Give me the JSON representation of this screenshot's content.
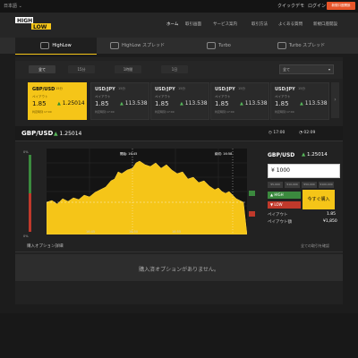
{
  "header": {
    "language": "日本語 ⌄",
    "quick_demo": "クイックデモ",
    "login": "ログイン",
    "free_account": "新規口座開設"
  },
  "logo": {
    "top": "HIGH",
    "bottom": "LOW"
  },
  "nav": [
    "ホーム",
    "取引画面",
    "サービス案内",
    "取引方法",
    "よくある質問",
    "新規口座開設"
  ],
  "tabs": [
    {
      "label": "HighLow",
      "icon": "highlow-icon"
    },
    {
      "label": "HighLow スプレッド",
      "icon": "spread-icon"
    },
    {
      "label": "Turbo",
      "icon": "turbo-icon"
    },
    {
      "label": "Turbo スプレッド",
      "icon": "turbo-spread-icon"
    }
  ],
  "filters": {
    "tabs": [
      "全て",
      "15分",
      "1時間",
      "1日"
    ],
    "select": "全て"
  },
  "cards": [
    {
      "pair": "GBP/USD",
      "time": "15分",
      "payout_label": "ペイアウト",
      "payout": "1.85",
      "rate": "1.25014",
      "closing": "判定時刻 17:00"
    },
    {
      "pair": "USD/JPY",
      "time": "15分",
      "payout_label": "ペイアウト",
      "payout": "1.85",
      "rate": "113.538",
      "closing": "判定時刻 17:00"
    },
    {
      "pair": "USD/JPY",
      "time": "15分",
      "payout_label": "ペイアウト",
      "payout": "1.85",
      "rate": "113.538",
      "closing": "判定時刻 17:00"
    },
    {
      "pair": "USD/JPY",
      "time": "15分",
      "payout_label": "ペイアウト",
      "payout": "1.85",
      "rate": "113.538",
      "closing": "判定時刻 17:00"
    },
    {
      "pair": "USD/JPY",
      "time": "15分",
      "payout_label": "ペイアウト",
      "payout": "1.85",
      "rate": "113.538",
      "closing": "判定時刻 17:00"
    }
  ],
  "main": {
    "pair": "GBP/USD",
    "rate": "1.25014",
    "close_time": "17:00",
    "remaining": "02:09"
  },
  "chart": {
    "open_label": "開始: 16:45",
    "close_label": "締切: 16:58",
    "x_ticks": [
      "16:45",
      "16:50",
      "16:55"
    ],
    "gauge_top": "0%",
    "gauge_bottom": "0%"
  },
  "trade": {
    "pair": "GBP/USD",
    "rate": "1.25014",
    "amount": "¥ 1000",
    "quick": [
      "¥5,000",
      "¥10,000",
      "¥50,000",
      "¥100,000"
    ],
    "high": "HIGH",
    "low": "LOW",
    "buy": "今すぐ購入",
    "payout_label": "ペイアウト",
    "payout": "1.85",
    "payout_amount_label": "ペイアウト額",
    "payout_amount": "¥1,850"
  },
  "purchased": {
    "label": "購入オプション詳細",
    "link": "全ての取引を確認",
    "empty": "購入済オプションがありません。"
  },
  "colors": {
    "accent": "#f5c518",
    "high": "#3b8a3e",
    "low": "#c0392b",
    "brand": "#e8552a"
  }
}
